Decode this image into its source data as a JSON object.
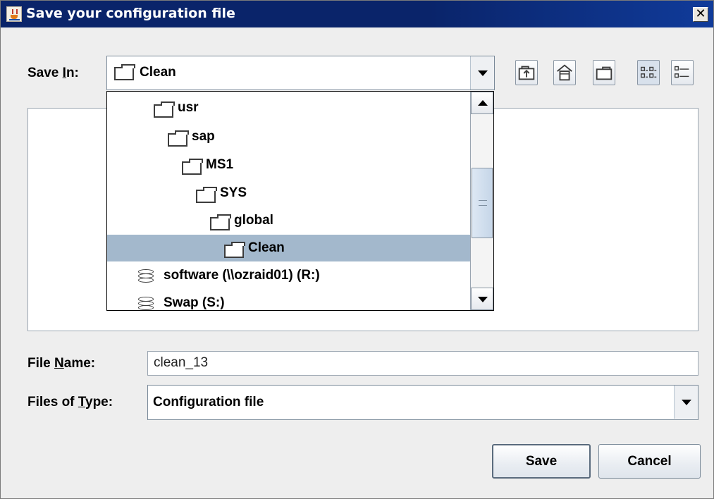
{
  "window": {
    "title": "Save your configuration file",
    "close_glyph": "✕"
  },
  "save_in": {
    "label_prefix": "Save ",
    "label_mnemonic": "I",
    "label_suffix": "n:",
    "selected": "Clean",
    "icon": "folder-icon"
  },
  "toolbar": {
    "buttons": [
      {
        "name": "up-one-level",
        "icon": "folder-up-icon"
      },
      {
        "name": "home",
        "icon": "home-icon"
      },
      {
        "name": "create-new-folder",
        "icon": "new-folder-icon"
      },
      {
        "name": "list-view",
        "icon": "list-view-icon",
        "pressed": true
      },
      {
        "name": "details-view",
        "icon": "details-view-icon"
      }
    ]
  },
  "dropdown": {
    "items": [
      {
        "label": "usr",
        "icon": "folder-icon",
        "selected": false
      },
      {
        "label": "sap",
        "icon": "folder-icon",
        "selected": false
      },
      {
        "label": "MS1",
        "icon": "folder-icon",
        "selected": false
      },
      {
        "label": "SYS",
        "icon": "folder-icon",
        "selected": false
      },
      {
        "label": "global",
        "icon": "folder-icon",
        "selected": false
      },
      {
        "label": "Clean",
        "icon": "folder-icon",
        "selected": true
      },
      {
        "label": "software (\\\\ozraid01) (R:)",
        "icon": "network-drive-icon",
        "selected": false
      },
      {
        "label": "Swap (S:)",
        "icon": "drive-icon",
        "selected": false
      }
    ]
  },
  "file_name": {
    "label_prefix": "File ",
    "label_mnemonic": "N",
    "label_suffix": "ame:",
    "value": "clean_13"
  },
  "files_of_type": {
    "label_prefix": "Files of ",
    "label_mnemonic": "T",
    "label_suffix": "ype:",
    "selected": "Configuration file"
  },
  "buttons": {
    "save": "Save",
    "cancel": "Cancel"
  },
  "colors": {
    "title_bar": "#0a246a",
    "selection": "#a3b8cc",
    "panel": "#eeeeee"
  }
}
